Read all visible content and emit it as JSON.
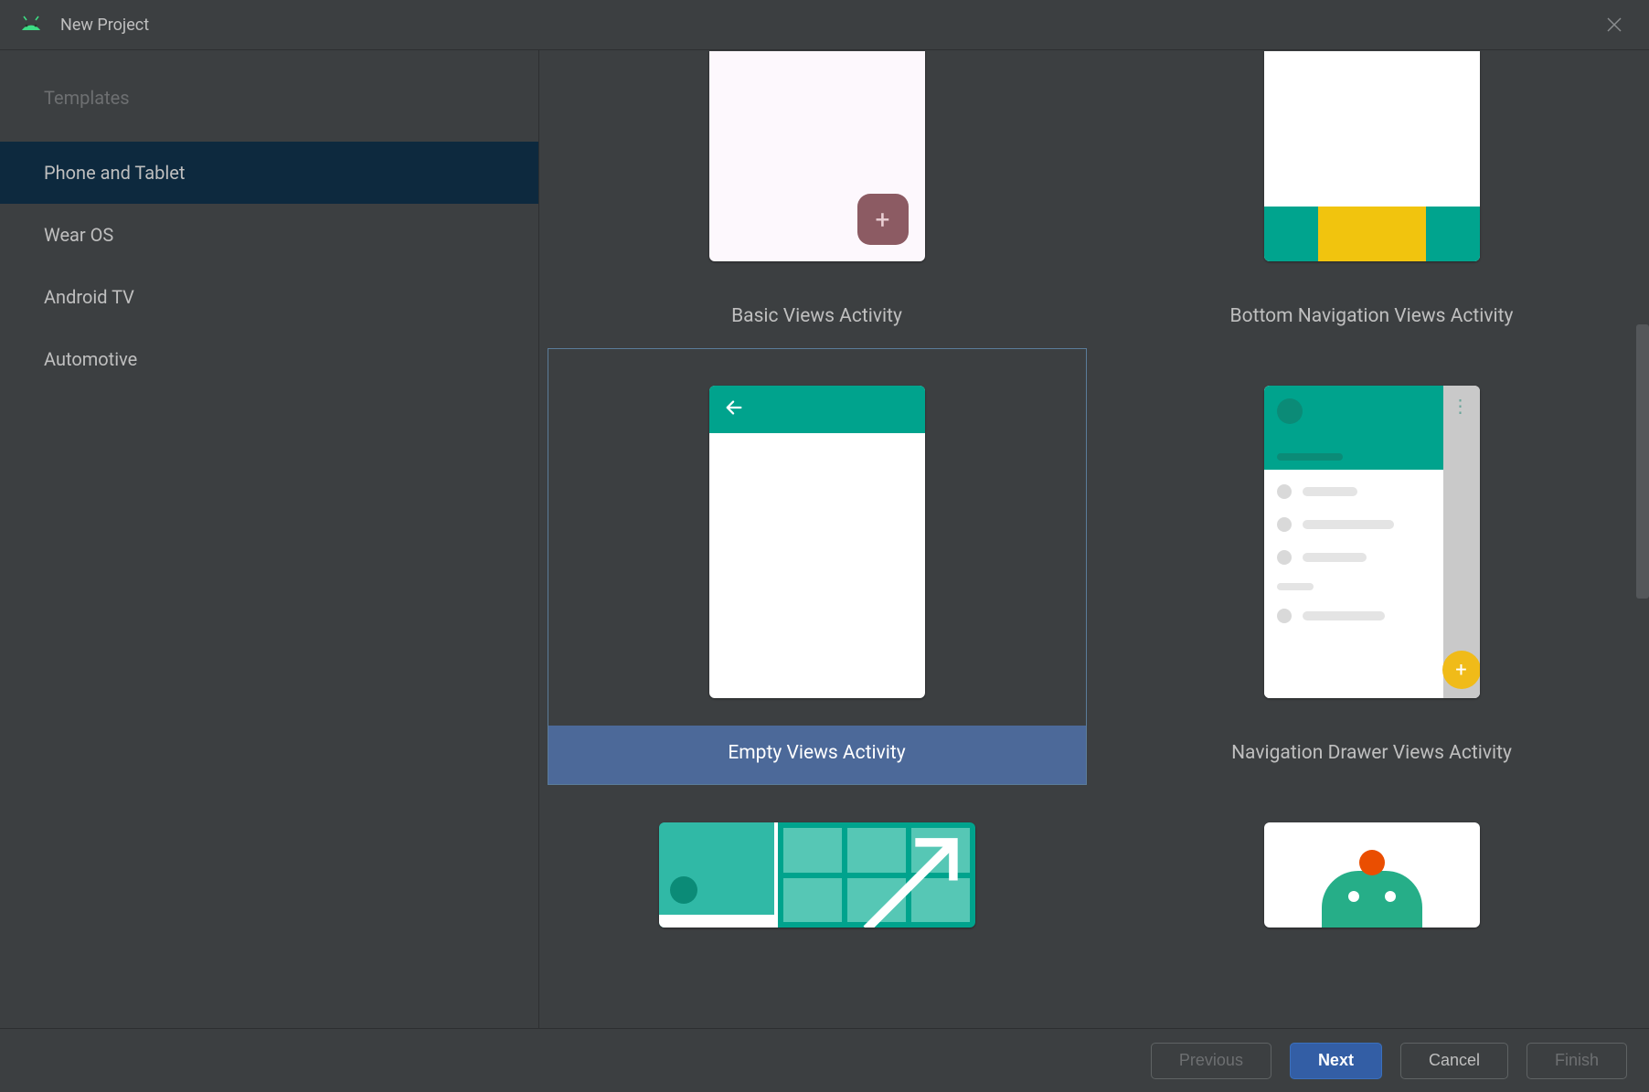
{
  "dialog": {
    "title": "New Project"
  },
  "sidebar": {
    "heading": "Templates",
    "items": [
      {
        "label": "Phone and Tablet",
        "selected": true
      },
      {
        "label": "Wear OS",
        "selected": false
      },
      {
        "label": "Android TV",
        "selected": false
      },
      {
        "label": "Automotive",
        "selected": false
      }
    ]
  },
  "templates": [
    {
      "id": "basic",
      "label": "Basic Views Activity",
      "selected": false
    },
    {
      "id": "bottomnav",
      "label": "Bottom Navigation Views Activity",
      "selected": false
    },
    {
      "id": "empty",
      "label": "Empty Views Activity",
      "selected": true
    },
    {
      "id": "navdrawer",
      "label": "Navigation Drawer Views Activity",
      "selected": false
    },
    {
      "id": "fullscreen",
      "label": "",
      "selected": false
    },
    {
      "id": "game",
      "label": "",
      "selected": false
    }
  ],
  "footer": {
    "previous": "Previous",
    "next": "Next",
    "cancel": "Cancel",
    "finish": "Finish"
  }
}
